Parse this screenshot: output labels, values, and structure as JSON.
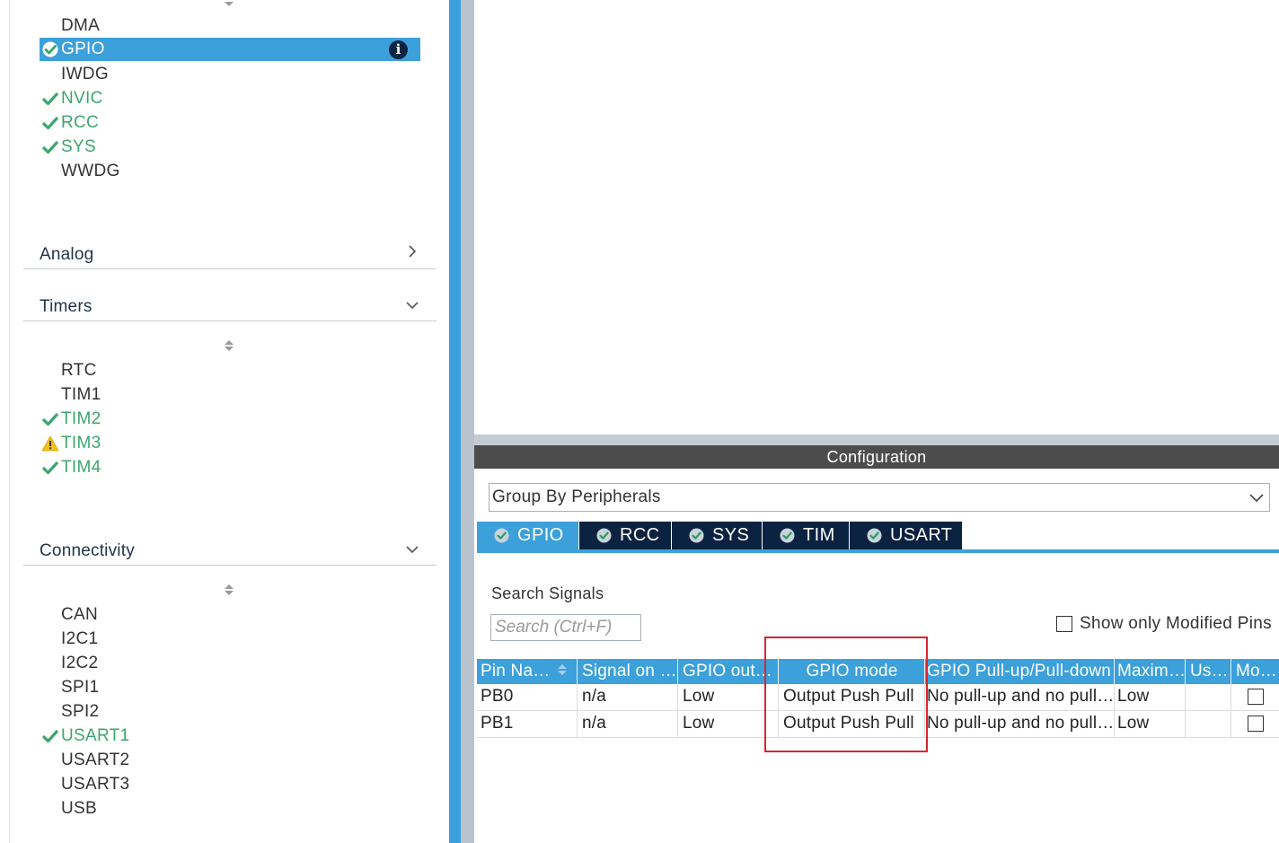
{
  "left_panel": {
    "system_core_items": [
      {
        "label": "DMA",
        "state": "plain"
      },
      {
        "label": "GPIO",
        "state": "selected"
      },
      {
        "label": "IWDG",
        "state": "plain"
      },
      {
        "label": "NVIC",
        "state": "ok"
      },
      {
        "label": "RCC",
        "state": "ok"
      },
      {
        "label": "SYS",
        "state": "ok"
      },
      {
        "label": "WWDG",
        "state": "plain"
      }
    ],
    "sections": {
      "analog": "Analog",
      "timers": "Timers",
      "connectivity": "Connectivity"
    },
    "timer_items": [
      {
        "label": "RTC",
        "state": "plain"
      },
      {
        "label": "TIM1",
        "state": "plain"
      },
      {
        "label": "TIM2",
        "state": "ok"
      },
      {
        "label": "TIM3",
        "state": "warn"
      },
      {
        "label": "TIM4",
        "state": "ok"
      }
    ],
    "connectivity_items": [
      {
        "label": "CAN",
        "state": "plain"
      },
      {
        "label": "I2C1",
        "state": "plain"
      },
      {
        "label": "I2C2",
        "state": "plain"
      },
      {
        "label": "SPI1",
        "state": "plain"
      },
      {
        "label": "SPI2",
        "state": "plain"
      },
      {
        "label": "USART1",
        "state": "ok"
      },
      {
        "label": "USART2",
        "state": "plain"
      },
      {
        "label": "USART3",
        "state": "plain"
      },
      {
        "label": "USB",
        "state": "plain"
      }
    ],
    "info_icon_glyph": "i"
  },
  "configuration": {
    "header": "Configuration",
    "group_by": "Group By Peripherals",
    "tabs": [
      {
        "label": "GPIO",
        "active": true
      },
      {
        "label": "RCC",
        "active": false
      },
      {
        "label": "SYS",
        "active": false
      },
      {
        "label": "TIM",
        "active": false
      },
      {
        "label": "USART",
        "active": false
      }
    ],
    "search_label": "Search Signals",
    "search_placeholder": "Search (Ctrl+F)",
    "search_value": "",
    "show_modified_label": "Show only Modified Pins",
    "show_modified_checked": false,
    "table": {
      "columns": [
        "Pin Na…",
        "Signal on …",
        "GPIO out…",
        "GPIO mode",
        "GPIO Pull-up/Pull-down",
        "Maxim…",
        "Us…",
        "Mo…"
      ],
      "rows": [
        {
          "pin": "PB0",
          "signal": "n/a",
          "output": "Low",
          "mode": "Output Push Pull",
          "pull": "No pull-up and no pull…",
          "speed": "Low",
          "user_label": "",
          "modified": false
        },
        {
          "pin": "PB1",
          "signal": "n/a",
          "output": "Low",
          "mode": "Output Push Pull",
          "pull": "No pull-up and no pull…",
          "speed": "Low",
          "user_label": "",
          "modified": false
        }
      ]
    }
  },
  "colors": {
    "accent_blue": "#3ca0db",
    "navy": "#0c2241",
    "ok_green": "#3ca56e",
    "warn_yellow": "#f2c21b",
    "highlight_red": "#d62631",
    "header_gray": "#4c4c4c"
  },
  "icons": {
    "check": "check-icon",
    "warning": "warning-icon",
    "info": "info-icon",
    "chevron_right": "chevron-right-icon",
    "chevron_down": "chevron-down-icon",
    "tab_check": "check-circle-icon",
    "sort": "sort-arrows-icon"
  }
}
